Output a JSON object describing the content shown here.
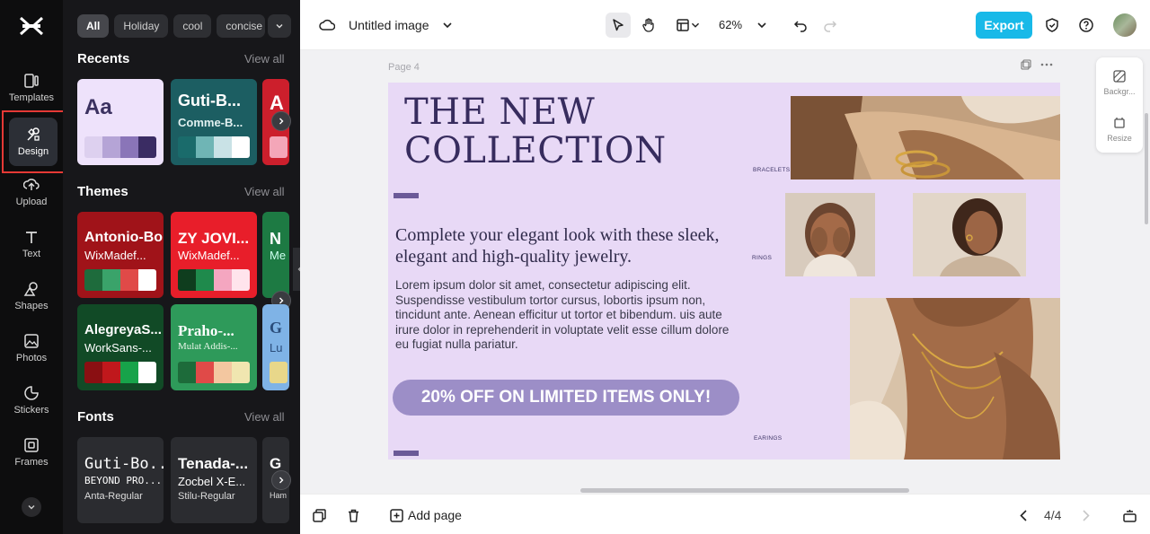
{
  "sidebar": {
    "items": [
      {
        "label": "Templates",
        "icon": "templates-icon"
      },
      {
        "label": "Design",
        "icon": "design-icon",
        "active": true
      },
      {
        "label": "Upload",
        "icon": "upload-icon"
      },
      {
        "label": "Text",
        "icon": "text-icon"
      },
      {
        "label": "Shapes",
        "icon": "shapes-icon"
      },
      {
        "label": "Photos",
        "icon": "photos-icon"
      },
      {
        "label": "Stickers",
        "icon": "stickers-icon"
      },
      {
        "label": "Frames",
        "icon": "frames-icon"
      }
    ]
  },
  "panel": {
    "chips": [
      "All",
      "Holiday",
      "cool",
      "concise"
    ],
    "recents": {
      "title": "Recents",
      "view_all": "View all",
      "cards": [
        {
          "t1": "Aa",
          "swatches": [
            "#ddd0ef",
            "#b5a4d6",
            "#8a75b8",
            "#5e4b8f",
            "#3a2c63"
          ]
        },
        {
          "t1": "Guti-B...",
          "t2": "Comme-B...",
          "swatches": [
            "#1a6b6b",
            "#6fb5b5",
            "#9fcfcf",
            "#c9e2e6",
            "#ffffff"
          ]
        },
        {
          "t1": "A",
          "swatches": [
            "#f4a6b8"
          ]
        }
      ]
    },
    "themes": {
      "title": "Themes",
      "view_all": "View all",
      "cards": [
        {
          "t1": "Antonio-Bold",
          "t2": "WixMadef...",
          "swatches": [
            "#1e6b3c",
            "#3aa36a",
            "#e04a48",
            "#ffffff"
          ]
        },
        {
          "t1": "ZY JOVI...",
          "t2": "WixMadef...",
          "swatches": [
            "#0f3d1e",
            "#1f8a4c",
            "#f4a6c0",
            "#ffe4ec"
          ]
        },
        {
          "t1": "N",
          "t2": "Me"
        },
        {
          "t1": "AlegreyaS...",
          "t2": "WorkSans-...",
          "swatches": [
            "#8a0f12",
            "#c0181c",
            "#17a34a",
            "#ffffff"
          ]
        },
        {
          "t1": "Praho-...",
          "t2": "Mulat Addis-...",
          "swatches": [
            "#1d6b3a",
            "#e04a48",
            "#f3c7a0",
            "#f0e6b0"
          ]
        },
        {
          "t1": "G",
          "t2": "Lu",
          "swatches": [
            "#e8d78a"
          ]
        }
      ]
    },
    "fonts": {
      "title": "Fonts",
      "view_all": "View all",
      "cards": [
        {
          "f1": "Guti-Bo...",
          "f2": "BEYOND PRO...",
          "f3": "Anta-Regular"
        },
        {
          "f1": "Tenada-...",
          "f2": "Zocbel X-E...",
          "f3": "Stilu-Regular"
        },
        {
          "f1": "G",
          "f3": "Ham"
        }
      ]
    }
  },
  "topbar": {
    "doc_title": "Untitled image",
    "zoom": "62%",
    "export_label": "Export"
  },
  "canvas": {
    "page_label": "Page 4",
    "design": {
      "headline_1": "THE NEW",
      "headline_2": "COLLECTION",
      "subhead": "Complete your elegant look with these sleek, elegant and high-quality jewelry.",
      "body": "Lorem ipsum dolor sit amet, consectetur adipiscing elit. Suspendisse vestibulum tortor cursus, lobortis ipsum non, tincidunt ante. Aenean efficitur ut tortor et bibendum. uis aute irure dolor in reprehenderit in voluptate velit esse cillum dolore eu fugiat nulla pariatur.",
      "promo": "20% OFF ON LIMITED ITEMS ONLY!",
      "tag_bracelets": "BRACELETS",
      "tag_rings": "RINGS",
      "tag_earings": "EARINGS",
      "background_color": "#e8d9f6",
      "accent_color": "#6b5a98"
    },
    "side_tools": [
      {
        "label": "Backgr...",
        "icon": "background-icon"
      },
      {
        "label": "Resize",
        "icon": "resize-icon"
      }
    ]
  },
  "bottombar": {
    "add_page": "Add page",
    "page_count": "4/4"
  }
}
